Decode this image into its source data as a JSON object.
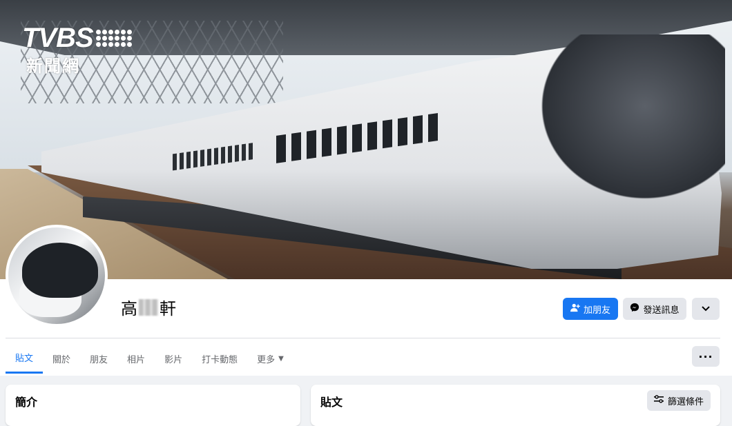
{
  "watermark": {
    "brand": "TVBS",
    "sub": "新聞網"
  },
  "profile": {
    "name_first": "高",
    "name_last": "軒"
  },
  "actions": {
    "add_friend": "加朋友",
    "send_message": "發送訊息",
    "more_icon": "chevron-down-icon"
  },
  "tabs": [
    {
      "label": "貼文",
      "active": true
    },
    {
      "label": "關於"
    },
    {
      "label": "朋友"
    },
    {
      "label": "相片"
    },
    {
      "label": "影片"
    },
    {
      "label": "打卡動態"
    },
    {
      "label": "更多"
    }
  ],
  "tabs_overflow": "···",
  "intro": {
    "title": "簡介"
  },
  "posts": {
    "title": "貼文",
    "filter_label": "篩選條件"
  },
  "colors": {
    "primary": "#1877f2",
    "secondary_bg": "#e4e6eb",
    "page_bg": "#f0f2f5"
  }
}
